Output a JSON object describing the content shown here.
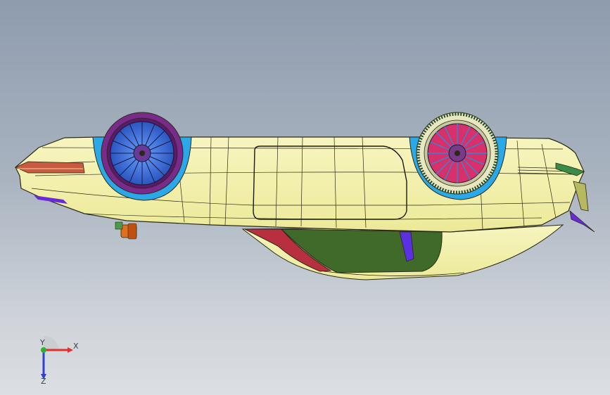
{
  "view": {
    "background_top": "#8f9cae",
    "background_bottom": "#dcdfe3"
  },
  "model": {
    "body_color": "#f5f3a8",
    "edge_color": "#2a2a18",
    "wheel_rim_color": "#3a6fd8",
    "wheel_tire_color": "#7a2a8a",
    "rear_wheel_accent": "#d8306a",
    "wheel_arch_color": "#2aa8e8",
    "underbody_green": "#3f6a2a",
    "underbody_red": "#b83040",
    "strut_color": "#6a2ad8",
    "taillight_color": "#c85a40",
    "orange_part_color": "#e07020"
  },
  "triad": {
    "x_label": "X",
    "y_label": "Y",
    "z_label": "Z",
    "x_color": "#e03030",
    "y_color": "#30b030",
    "z_color": "#3040d0"
  }
}
